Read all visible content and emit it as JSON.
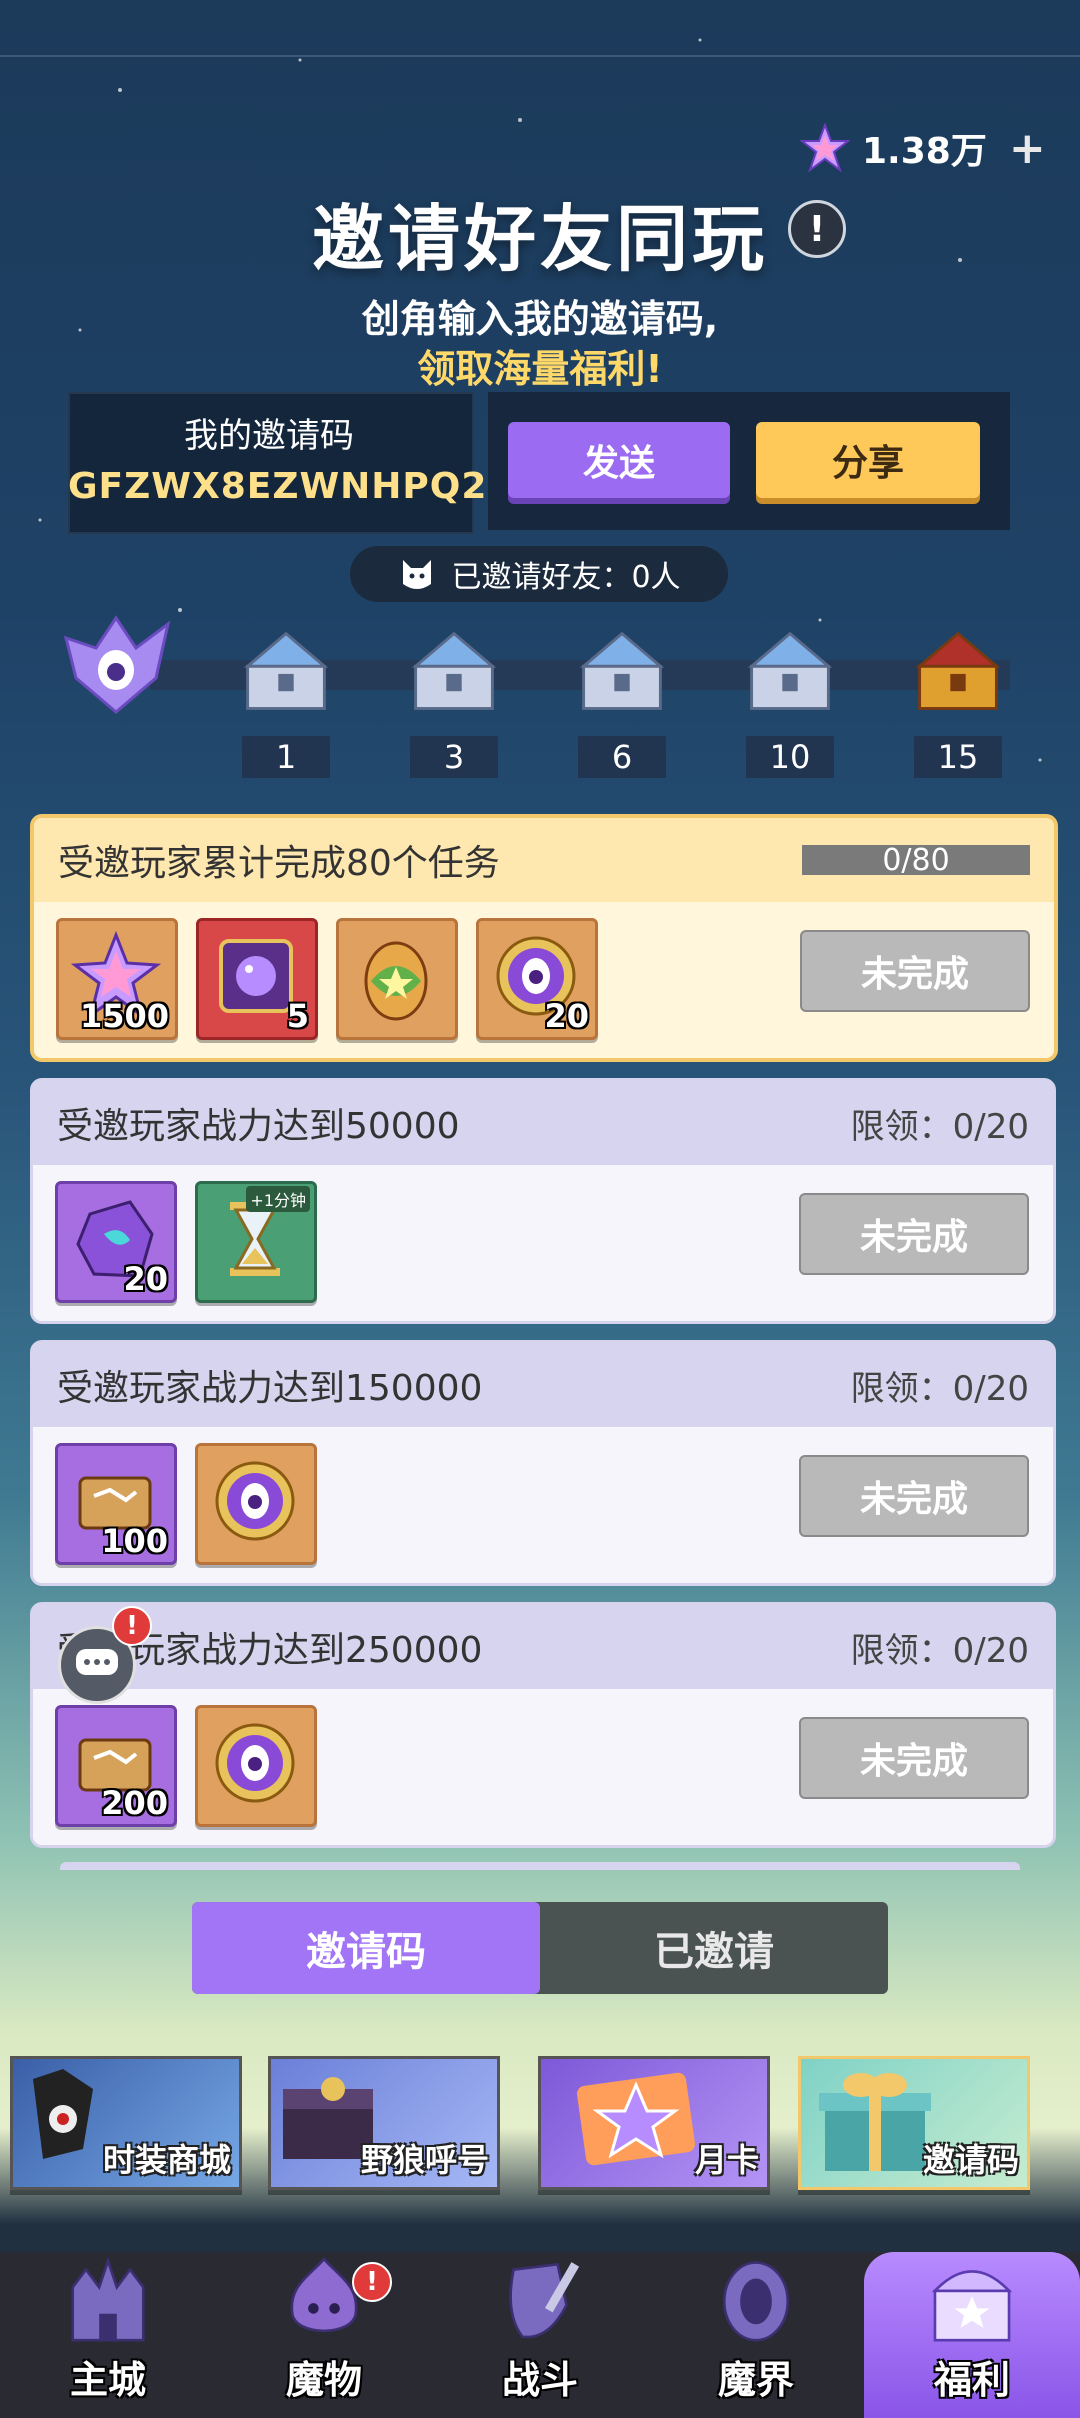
{
  "currency": {
    "amount": "1.38万",
    "icon": "star-gem-icon",
    "plus": "+"
  },
  "header": {
    "title": "邀请好友同玩",
    "info": "!",
    "subtitle_line1": "创角输入我的邀请码,",
    "subtitle_line2": "领取海量福利!"
  },
  "invite_code": {
    "label": "我的邀请码",
    "value": "GFZWX8EZWNHPQ2"
  },
  "actions": {
    "send": "发送",
    "share": "分享"
  },
  "invited_count": "已邀请好友：0人",
  "milestones": [
    "1",
    "3",
    "6",
    "10",
    "15"
  ],
  "tasks": [
    {
      "title": "受邀玩家累计完成80个任务",
      "progress": "0/80",
      "status": "未完成",
      "rewards": [
        {
          "icon": "star-crystal-icon",
          "qty": "1500"
        },
        {
          "icon": "galaxy-scroll-icon",
          "qty": "5"
        },
        {
          "icon": "egg-icon",
          "qty": ""
        },
        {
          "icon": "summon-token-icon",
          "qty": "20"
        }
      ]
    },
    {
      "title": "受邀玩家战力达到50000",
      "limit": "限领：0/20",
      "status": "未完成",
      "rewards": [
        {
          "icon": "purple-ore-icon",
          "qty": "20"
        },
        {
          "icon": "hourglass-icon",
          "qty": "",
          "tag": "+1分钟"
        }
      ]
    },
    {
      "title": "受邀玩家战力达到150000",
      "limit": "限领：0/20",
      "status": "未完成",
      "rewards": [
        {
          "icon": "scroll-icon",
          "qty": "100"
        },
        {
          "icon": "summon-token-icon",
          "qty": ""
        }
      ]
    },
    {
      "title": "受邀玩家战力达到250000",
      "limit": "限领：0/20",
      "status": "未完成",
      "rewards": [
        {
          "icon": "scroll-icon",
          "qty": "200"
        },
        {
          "icon": "summon-token-icon",
          "qty": ""
        }
      ]
    }
  ],
  "tabs": {
    "invite_code": "邀请码",
    "invited": "已邀请"
  },
  "shortcuts": [
    "时装商城",
    "野狼呼号",
    "月卡",
    "邀请码"
  ],
  "nav": [
    "主城",
    "魔物",
    "战斗",
    "魔界",
    "福利"
  ],
  "colors": {
    "accent_purple": "#a175f5",
    "accent_gold": "#ffc95a",
    "highlight_text": "#ffe08a"
  }
}
